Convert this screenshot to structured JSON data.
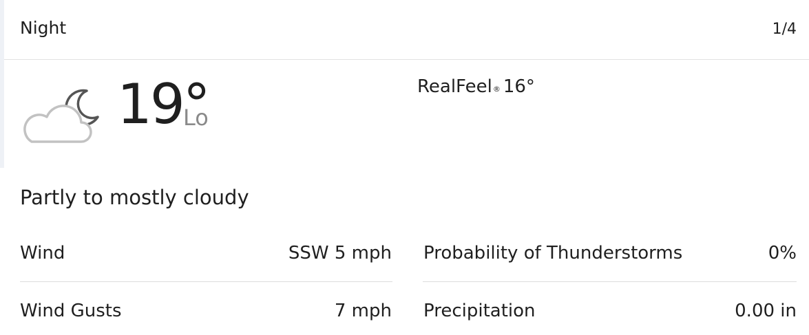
{
  "header": {
    "title": "Night",
    "page_indicator": "1/4"
  },
  "current": {
    "icon": "partly-cloudy-night-icon",
    "temperature": "19°",
    "temperature_label": "Lo",
    "realfeel_label": "RealFeel",
    "realfeel_mark": "®",
    "realfeel_value": "16°",
    "phrase": "Partly to mostly cloudy"
  },
  "details": {
    "left": [
      {
        "label": "Wind",
        "value": "SSW 5 mph"
      },
      {
        "label": "Wind Gusts",
        "value": "7 mph"
      }
    ],
    "right": [
      {
        "label": "Probability of Thunderstorms",
        "value": "0%"
      },
      {
        "label": "Precipitation",
        "value": "0.00 in"
      }
    ]
  },
  "colors": {
    "text": "#1f1f1f",
    "muted": "#8a8a8a",
    "divider": "#dcdcdc",
    "rail": "#eef1f6"
  }
}
